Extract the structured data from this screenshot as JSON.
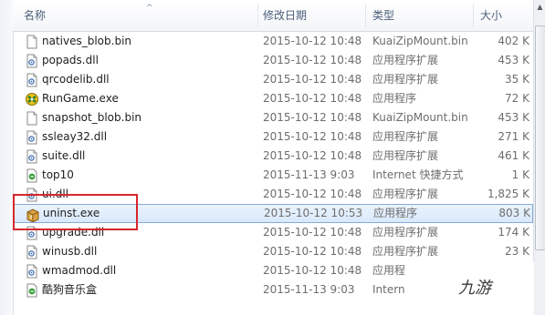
{
  "columns": {
    "name": "名称",
    "date": "修改日期",
    "type": "类型",
    "size": "大小"
  },
  "files": [
    {
      "name": "natives_blob.bin",
      "date": "2015-10-12 10:48",
      "type": "KuaiZipMount.bin",
      "size": "402 K",
      "icon": "blank-file-icon"
    },
    {
      "name": "popads.dll",
      "date": "2015-10-12 10:48",
      "type": "应用程序扩展",
      "size": "453 K",
      "icon": "dll-file-icon"
    },
    {
      "name": "qrcodelib.dll",
      "date": "2015-10-12 10:48",
      "type": "应用程序扩展",
      "size": "35 K",
      "icon": "dll-file-icon"
    },
    {
      "name": "RunGame.exe",
      "date": "2015-10-12 10:48",
      "type": "应用程序",
      "size": "72 K",
      "icon": "game-app-icon"
    },
    {
      "name": "snapshot_blob.bin",
      "date": "2015-10-12 10:48",
      "type": "KuaiZipMount.bin",
      "size": "453 K",
      "icon": "blank-file-icon"
    },
    {
      "name": "ssleay32.dll",
      "date": "2015-10-12 10:48",
      "type": "应用程序扩展",
      "size": "271 K",
      "icon": "dll-file-icon"
    },
    {
      "name": "suite.dll",
      "date": "2015-10-12 10:48",
      "type": "应用程序扩展",
      "size": "461 K",
      "icon": "dll-file-icon"
    },
    {
      "name": "top10",
      "date": "2015-11-13 9:03",
      "type": "Internet 快捷方式",
      "size": "1 K",
      "icon": "internet-shortcut-icon"
    },
    {
      "name": "ui.dll",
      "date": "2015-10-12 10:48",
      "type": "应用程序扩展",
      "size": "1,825 K",
      "icon": "dll-file-icon"
    },
    {
      "name": "uninst.exe",
      "date": "2015-10-12 10:53",
      "type": "应用程序",
      "size": "803 K",
      "icon": "installer-box-icon",
      "selected": true
    },
    {
      "name": "upgrade.dll",
      "date": "2015-10-12 10:48",
      "type": "应用程序扩展",
      "size": "174 K",
      "icon": "dll-file-icon"
    },
    {
      "name": "winusb.dll",
      "date": "2015-10-12 10:48",
      "type": "应用程序扩展",
      "size": "23 K",
      "icon": "dll-file-icon"
    },
    {
      "name": "wmadmod.dll",
      "date": "2015-10-12 10:48",
      "type": "应用程",
      "size": "",
      "icon": "dll-file-icon"
    },
    {
      "name": "酷狗音乐盒",
      "date": "2015-11-13 9:03",
      "type": "Intern",
      "size": "",
      "icon": "internet-shortcut-icon"
    }
  ],
  "watermark": "九游",
  "colors": {
    "selection_border": "#84acdd",
    "selection_fill": "#d9e9fb",
    "highlight_box": "#d8262e"
  }
}
